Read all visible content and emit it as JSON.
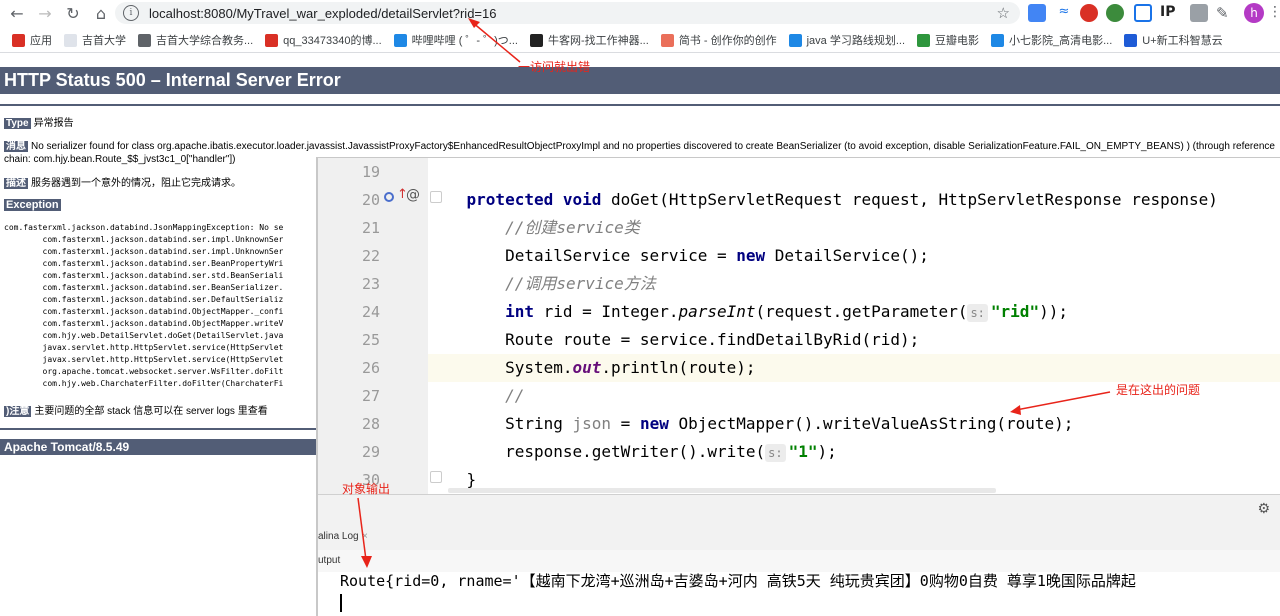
{
  "browser": {
    "url": "localhost:8080/MyTravel_war_exploded/detailServlet?rid=16",
    "ext_ip": "IP",
    "avatar_letter": "h"
  },
  "bookmarks": [
    {
      "label": "应用",
      "color": "#d93025"
    },
    {
      "label": "吉首大学",
      "color": "#dfe3ea"
    },
    {
      "label": "吉首大学综合教务...",
      "color": "#5f6368"
    },
    {
      "label": "qq_33473340的博...",
      "color": "#d93025"
    },
    {
      "label": "哔哩哔哩 ( ゜- ゜)つ...",
      "color": "#1e88e5"
    },
    {
      "label": "牛客网-找工作神器...",
      "color": "#222222"
    },
    {
      "label": "简书 - 创作你的创作",
      "color": "#ea6f5a"
    },
    {
      "label": "java 学习路线规划...",
      "color": "#1e88e5"
    },
    {
      "label": "豆瓣电影",
      "color": "#2e963d"
    },
    {
      "label": "小七影院_高清电影...",
      "color": "#1e88e5"
    },
    {
      "label": "U+新工科智慧云",
      "color": "#1e5bd6"
    }
  ],
  "error": {
    "title": "HTTP Status 500 – Internal Server Error",
    "type_label": "Type",
    "type_value": "异常报告",
    "message_label": "消息",
    "message_line1": "No serializer found for class org.apache.ibatis.executor.loader.javassist.JavassistProxyFactory$EnhancedResultObjectProxyImpl and no properties discovered to create BeanSerializer (to avoid exception, disable SerializationFeature.FAIL_ON_EMPTY_BEANS) ) (through reference",
    "message_line2": "chain: com.hjy.bean.Route_$$_jvst3c1_0[\"handler\"])",
    "desc_label": "描述",
    "desc_value": "服务器遇到一个意外的情况，阻止它完成请求。",
    "exception_label": "Exception",
    "stack": [
      "com.fasterxml.jackson.databind.JsonMappingException: No se",
      "        com.fasterxml.jackson.databind.ser.impl.UnknownSer",
      "        com.fasterxml.jackson.databind.ser.impl.UnknownSer",
      "        com.fasterxml.jackson.databind.ser.BeanPropertyWri",
      "        com.fasterxml.jackson.databind.ser.std.BeanSeriali",
      "        com.fasterxml.jackson.databind.ser.BeanSerializer.",
      "        com.fasterxml.jackson.databind.ser.DefaultSerializ",
      "        com.fasterxml.jackson.databind.ObjectMapper._confi",
      "        com.fasterxml.jackson.databind.ObjectMapper.writeV",
      "        com.hjy.web.DetailServlet.doGet(DetailServlet.java",
      "        javax.servlet.http.HttpServlet.service(HttpServlet",
      "        javax.servlet.http.HttpServlet.service(HttpServlet",
      "        org.apache.tomcat.websocket.server.WsFilter.doFilt",
      "        com.hjy.web.CharchaterFilter.doFilter(CharchaterFi"
    ],
    "note_label": ")注意",
    "note_value": "主要问题的全部 stack 信息可以在 server logs 里查看",
    "footer": "Apache Tomcat/8.5.49"
  },
  "ide": {
    "lines": [
      {
        "n": "19",
        "html": ""
      },
      {
        "n": "20",
        "html": "    <span class=\"kw\">protected void</span> doGet(HttpServletRequest request, HttpServletResponse response)"
      },
      {
        "n": "21",
        "html": "        <span class=\"cm\">//创建service类</span>"
      },
      {
        "n": "22",
        "html": "        DetailService service = <span class=\"kw\">new</span> DetailService();"
      },
      {
        "n": "23",
        "html": "        <span class=\"cm\">//调用service方法</span>"
      },
      {
        "n": "24",
        "html": "        <span class=\"kw\">int</span> rid = Integer.<span class=\"ital\">parseInt</span>(request.getParameter(<span class=\"hint\">s:</span><span class=\"str\">\"rid\"</span>));"
      },
      {
        "n": "25",
        "html": "        Route route = service.findDetailByRid(rid);"
      },
      {
        "n": "26",
        "html": "        System.<span class=\"fld\">out</span>.println(route);"
      },
      {
        "n": "27",
        "html": "        <span class=\"cm\">//</span>"
      },
      {
        "n": "28",
        "html": "        String <span class=\"unused\">json</span> = <span class=\"kw\">new</span> ObjectMapper().writeValueAsString(route);"
      },
      {
        "n": "29",
        "html": "        response.getWriter().write(<span class=\"hint\">s:</span><span class=\"str\">\"1\"</span>);"
      },
      {
        "n": "30",
        "html": "    }"
      }
    ],
    "tab_label": "alina Log",
    "tab_close": "×",
    "output_label": "utput",
    "console_line": "Route{rid=0, rname='【越南下龙湾+巡洲岛+吉婆岛+河内 高铁5天 纯玩贵宾团】0购物0自费 尊享1晚国际品牌起"
  },
  "annotations": {
    "visit_error": "一访问就出错",
    "problem_here": "是在这出的问题",
    "object_output": "对象输出"
  },
  "colors": {
    "tomcat_header": "#525d76",
    "annotation_red": "#e8241a"
  }
}
